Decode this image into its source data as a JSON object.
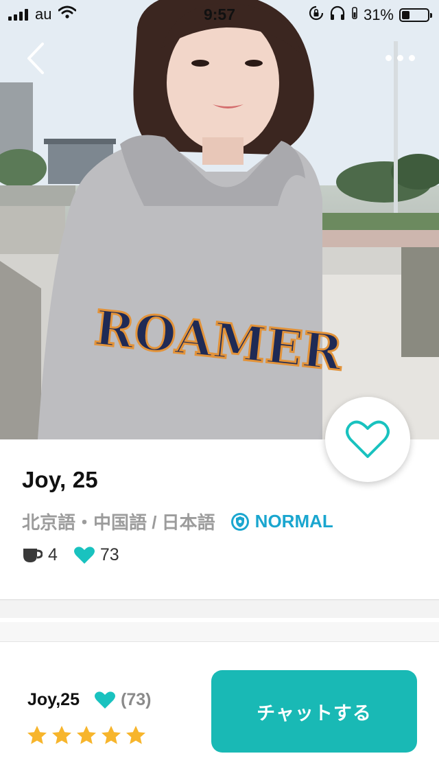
{
  "status_bar": {
    "carrier": "au",
    "time": "9:57",
    "battery_percent": "31%",
    "battery_level": 0.31
  },
  "profile": {
    "name_age": "Joy, 25",
    "languages": "北京語・中国語 / 日本語",
    "badge": "NORMAL",
    "coffee_count": "4",
    "like_count": "73",
    "photo_text": "ROAMER"
  },
  "bottom_bar": {
    "name_age": "Joy,25",
    "likes": "(73)",
    "rating": 5,
    "chat_label": "チャットする"
  },
  "colors": {
    "accent": "#19b9b5",
    "heart": "#19c2bf",
    "badge": "#1aa6cf",
    "star": "#f7b52c"
  },
  "icons": [
    "back-chevron-icon",
    "more-dots-icon",
    "heart-outline-icon",
    "shield-icon",
    "coffee-cup-icon",
    "heart-icon",
    "star-icon",
    "signal-icon",
    "wifi-icon",
    "lock-rotation-icon",
    "headphones-icon",
    "battery-icon"
  ]
}
